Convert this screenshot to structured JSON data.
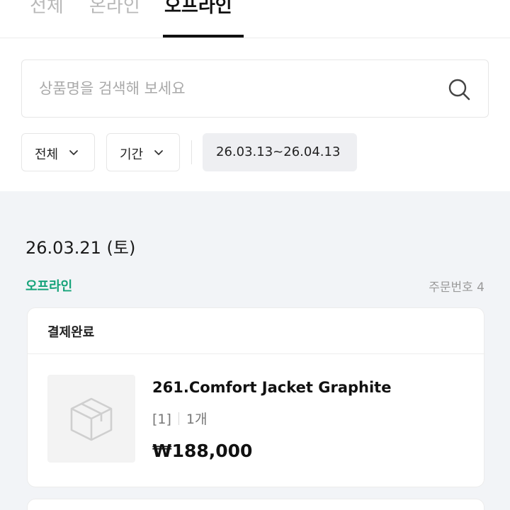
{
  "tabs": [
    {
      "label": "전체"
    },
    {
      "label": "온라인"
    },
    {
      "label": "오프라인"
    }
  ],
  "active_tab": "오프라인",
  "search": {
    "placeholder": "상품명을 검색해 보세요",
    "value": ""
  },
  "filters": {
    "status": {
      "label": "전체"
    },
    "period": {
      "label": "기간"
    },
    "date_range": {
      "label": "26.03.13~26.04.13"
    }
  },
  "order_group": {
    "date": "26.03.21 (토)",
    "channel": "오프라인",
    "order_number": "주문번호 4",
    "order": {
      "status": "결제완료",
      "item": {
        "thumbnail_icon": "box-icon",
        "name": "261.Comfort Jacket Graphite",
        "option": "[1]",
        "quantity": "1개",
        "price": "₩188,000"
      }
    }
  },
  "colors": {
    "accent_green": "#16a37a",
    "tab_active": "#111111",
    "tab_inactive": "#b8b8b8",
    "section_bg": "#f2f4f7"
  }
}
